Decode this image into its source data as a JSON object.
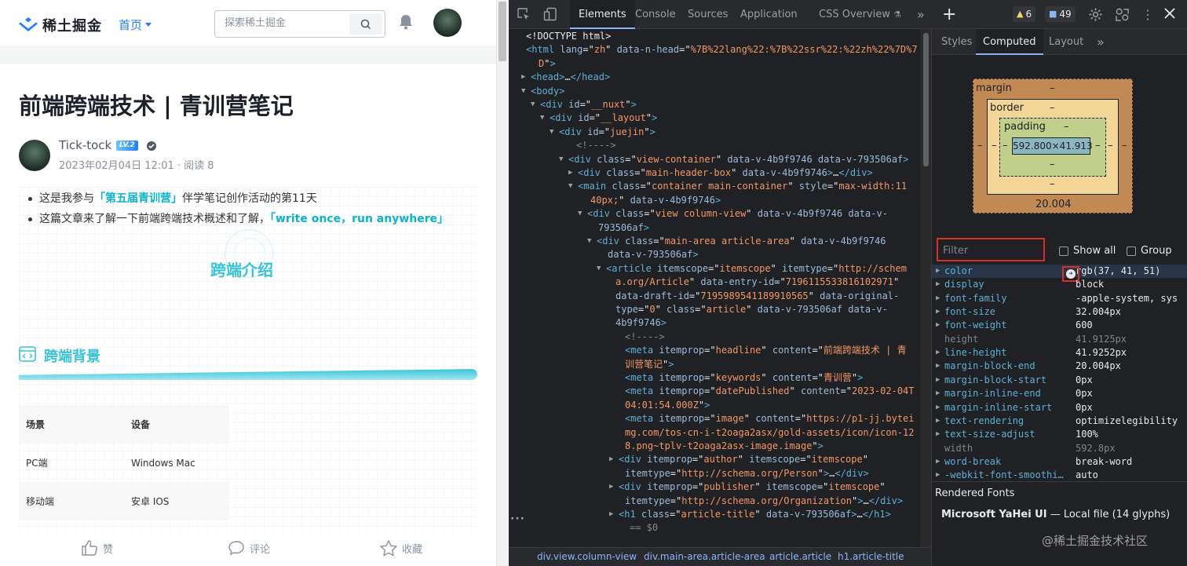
{
  "page": {
    "logo_text": "稀土掘金",
    "nav_home": "首页",
    "search_placeholder": "探索稀土掘金",
    "article_title": "前端跨端技术 | 青训营笔记",
    "author": "Tick-tock",
    "level_badge": "LV.2",
    "meta": "2023年02月04日 12:01 ·  阅读 8",
    "bullets": [
      {
        "pre": "这是我参与",
        "hl": "「第五届青训营」",
        "post": "伴学笔记创作活动的第11天"
      },
      {
        "pre": "这篇文章来了解一下前端跨端技术概述和了解，",
        "hl": "「write once，run anywhere」",
        "post": ""
      }
    ],
    "banner_title": "跨端介绍",
    "section_title": "跨端背景",
    "table": {
      "headers": [
        "场景",
        "设备"
      ],
      "rows": [
        [
          "PC端",
          "Windows Mac"
        ],
        [
          "移动端",
          "安卓 IOS"
        ]
      ]
    },
    "actions": [
      "赞",
      "评论",
      "收藏"
    ]
  },
  "devtools": {
    "tabs": [
      "Elements",
      "Console",
      "Sources",
      "Application",
      "CSS Overview"
    ],
    "warnings": "6",
    "messages": "49",
    "dom_lines": [
      [
        {
          "c": "tx",
          "t": "<!DOCTYPE html>"
        }
      ],
      [
        {
          "c": "tg",
          "t": "<html "
        },
        {
          "c": "at",
          "t": "lang"
        },
        {
          "c": "tx",
          "t": "=\""
        },
        {
          "c": "av",
          "t": "zh"
        },
        {
          "c": "tx",
          "t": "\" "
        },
        {
          "c": "at",
          "t": "data-n-head"
        },
        {
          "c": "tx",
          "t": "=\""
        },
        {
          "c": "av",
          "t": "%7B%22lang%22:%7B%22ssr%22:%22zh%22%7D%7"
        }
      ],
      [
        {
          "c": "av",
          "t": "D"
        },
        {
          "c": "tx",
          "t": "\""
        },
        {
          "c": "tg",
          "t": ">"
        }
      ],
      [
        {
          "c": "tg",
          "t": "<head>"
        },
        {
          "c": "tx",
          "t": "…"
        },
        {
          "c": "tg",
          "t": "</head>"
        }
      ],
      [
        {
          "c": "tg",
          "t": "<body>"
        }
      ],
      [
        {
          "c": "tg",
          "t": "<div "
        },
        {
          "c": "at",
          "t": "id"
        },
        {
          "c": "tx",
          "t": "=\""
        },
        {
          "c": "av",
          "t": "__nuxt"
        },
        {
          "c": "tx",
          "t": "\""
        },
        {
          "c": "tg",
          "t": ">"
        }
      ],
      [
        {
          "c": "tg",
          "t": "<div "
        },
        {
          "c": "at",
          "t": "id"
        },
        {
          "c": "tx",
          "t": "=\""
        },
        {
          "c": "av",
          "t": "__layout"
        },
        {
          "c": "tx",
          "t": "\""
        },
        {
          "c": "tg",
          "t": ">"
        }
      ],
      [
        {
          "c": "tg",
          "t": "<div "
        },
        {
          "c": "at",
          "t": "id"
        },
        {
          "c": "tx",
          "t": "=\""
        },
        {
          "c": "av",
          "t": "juejin"
        },
        {
          "c": "tx",
          "t": "\""
        },
        {
          "c": "tg",
          "t": ">"
        }
      ],
      [
        {
          "c": "cm",
          "t": "<!---->"
        }
      ],
      [
        {
          "c": "tg",
          "t": "<div "
        },
        {
          "c": "at",
          "t": "class"
        },
        {
          "c": "tx",
          "t": "=\""
        },
        {
          "c": "av",
          "t": "view-container"
        },
        {
          "c": "tx",
          "t": "\" "
        },
        {
          "c": "at",
          "t": "data-v-4b9f9746 data-v-793506af"
        },
        {
          "c": "tg",
          "t": ">"
        }
      ],
      [
        {
          "c": "tg",
          "t": "<div "
        },
        {
          "c": "at",
          "t": "class"
        },
        {
          "c": "tx",
          "t": "=\""
        },
        {
          "c": "av",
          "t": "main-header-box"
        },
        {
          "c": "tx",
          "t": "\" "
        },
        {
          "c": "at",
          "t": "data-v-4b9f9746"
        },
        {
          "c": "tg",
          "t": ">"
        },
        {
          "c": "tx",
          "t": "…"
        },
        {
          "c": "tg",
          "t": "</div>"
        }
      ],
      [
        {
          "c": "tg",
          "t": "<main "
        },
        {
          "c": "at",
          "t": "class"
        },
        {
          "c": "tx",
          "t": "=\""
        },
        {
          "c": "av",
          "t": "container main-container"
        },
        {
          "c": "tx",
          "t": "\" "
        },
        {
          "c": "at",
          "t": "style"
        },
        {
          "c": "tx",
          "t": "=\""
        },
        {
          "c": "av",
          "t": "max-width:11"
        }
      ],
      [
        {
          "c": "av",
          "t": "40px;"
        },
        {
          "c": "tx",
          "t": "\" "
        },
        {
          "c": "at",
          "t": "data-v-4b9f9746"
        },
        {
          "c": "tg",
          "t": ">"
        }
      ],
      [
        {
          "c": "tg",
          "t": "<div "
        },
        {
          "c": "at",
          "t": "class"
        },
        {
          "c": "tx",
          "t": "=\""
        },
        {
          "c": "av",
          "t": "view column-view"
        },
        {
          "c": "tx",
          "t": "\" "
        },
        {
          "c": "at",
          "t": "data-v-4b9f9746 data-v-"
        }
      ],
      [
        {
          "c": "at",
          "t": "793506af"
        },
        {
          "c": "tg",
          "t": ">"
        }
      ],
      [
        {
          "c": "tg",
          "t": "<div "
        },
        {
          "c": "at",
          "t": "class"
        },
        {
          "c": "tx",
          "t": "=\""
        },
        {
          "c": "av",
          "t": "main-area article-area"
        },
        {
          "c": "tx",
          "t": "\" "
        },
        {
          "c": "at",
          "t": "data-v-4b9f9746"
        }
      ],
      [
        {
          "c": "at",
          "t": "data-v-793506af"
        },
        {
          "c": "tg",
          "t": ">"
        }
      ],
      [
        {
          "c": "tg",
          "t": "<article "
        },
        {
          "c": "at",
          "t": "itemscope"
        },
        {
          "c": "tx",
          "t": "=\""
        },
        {
          "c": "av",
          "t": "itemscope"
        },
        {
          "c": "tx",
          "t": "\" "
        },
        {
          "c": "at",
          "t": "itemtype"
        },
        {
          "c": "tx",
          "t": "=\""
        },
        {
          "c": "av",
          "t": "http://schem"
        }
      ],
      [
        {
          "c": "av",
          "t": "a.org/Article"
        },
        {
          "c": "tx",
          "t": "\" "
        },
        {
          "c": "at",
          "t": "data-entry-id"
        },
        {
          "c": "tx",
          "t": "=\""
        },
        {
          "c": "av",
          "t": "7196115533816102971"
        },
        {
          "c": "tx",
          "t": "\""
        }
      ],
      [
        {
          "c": "at",
          "t": "data-draft-id"
        },
        {
          "c": "tx",
          "t": "=\""
        },
        {
          "c": "av",
          "t": "7195989541189910565"
        },
        {
          "c": "tx",
          "t": "\" "
        },
        {
          "c": "at",
          "t": "data-original-"
        }
      ],
      [
        {
          "c": "at",
          "t": "type"
        },
        {
          "c": "tx",
          "t": "=\""
        },
        {
          "c": "av",
          "t": "0"
        },
        {
          "c": "tx",
          "t": "\" "
        },
        {
          "c": "at",
          "t": "class"
        },
        {
          "c": "tx",
          "t": "=\""
        },
        {
          "c": "av",
          "t": "article"
        },
        {
          "c": "tx",
          "t": "\" "
        },
        {
          "c": "at",
          "t": "data-v-793506af data-v-"
        }
      ],
      [
        {
          "c": "at",
          "t": "4b9f9746"
        },
        {
          "c": "tg",
          "t": ">"
        }
      ],
      [
        {
          "c": "cm",
          "t": "<!---->"
        }
      ],
      [
        {
          "c": "tg",
          "t": "<meta "
        },
        {
          "c": "at",
          "t": "itemprop"
        },
        {
          "c": "tx",
          "t": "=\""
        },
        {
          "c": "av",
          "t": "headline"
        },
        {
          "c": "tx",
          "t": "\" "
        },
        {
          "c": "at",
          "t": "content"
        },
        {
          "c": "tx",
          "t": "=\""
        },
        {
          "c": "av",
          "t": "前端跨端技术 | 青"
        }
      ],
      [
        {
          "c": "av",
          "t": "训营笔记"
        },
        {
          "c": "tx",
          "t": "\""
        },
        {
          "c": "tg",
          "t": ">"
        }
      ],
      [
        {
          "c": "tg",
          "t": "<meta "
        },
        {
          "c": "at",
          "t": "itemprop"
        },
        {
          "c": "tx",
          "t": "=\""
        },
        {
          "c": "av",
          "t": "keywords"
        },
        {
          "c": "tx",
          "t": "\" "
        },
        {
          "c": "at",
          "t": "content"
        },
        {
          "c": "tx",
          "t": "=\""
        },
        {
          "c": "av",
          "t": "青训营"
        },
        {
          "c": "tx",
          "t": "\""
        },
        {
          "c": "tg",
          "t": ">"
        }
      ],
      [
        {
          "c": "tg",
          "t": "<meta "
        },
        {
          "c": "at",
          "t": "itemprop"
        },
        {
          "c": "tx",
          "t": "=\""
        },
        {
          "c": "av",
          "t": "datePublished"
        },
        {
          "c": "tx",
          "t": "\" "
        },
        {
          "c": "at",
          "t": "content"
        },
        {
          "c": "tx",
          "t": "=\""
        },
        {
          "c": "av",
          "t": "2023-02-04T"
        }
      ],
      [
        {
          "c": "av",
          "t": "04:01:54.000Z"
        },
        {
          "c": "tx",
          "t": "\""
        },
        {
          "c": "tg",
          "t": ">"
        }
      ],
      [
        {
          "c": "tg",
          "t": "<meta "
        },
        {
          "c": "at",
          "t": "itemprop"
        },
        {
          "c": "tx",
          "t": "=\""
        },
        {
          "c": "av",
          "t": "image"
        },
        {
          "c": "tx",
          "t": "\" "
        },
        {
          "c": "at",
          "t": "content"
        },
        {
          "c": "tx",
          "t": "=\""
        },
        {
          "c": "av",
          "t": "https://p1-jj.bytei"
        }
      ],
      [
        {
          "c": "av",
          "t": "mg.com/tos-cn-i-t2oaga2asx/gold-assets/icon/icon-12"
        }
      ],
      [
        {
          "c": "av",
          "t": "8.png~tplv-t2oaga2asx-image.image"
        },
        {
          "c": "tx",
          "t": "\""
        },
        {
          "c": "tg",
          "t": ">"
        }
      ],
      [
        {
          "c": "tg",
          "t": "<div "
        },
        {
          "c": "at",
          "t": "itemprop"
        },
        {
          "c": "tx",
          "t": "=\""
        },
        {
          "c": "av",
          "t": "author"
        },
        {
          "c": "tx",
          "t": "\" "
        },
        {
          "c": "at",
          "t": "itemscope"
        },
        {
          "c": "tx",
          "t": "=\""
        },
        {
          "c": "av",
          "t": "itemscope"
        },
        {
          "c": "tx",
          "t": "\""
        }
      ],
      [
        {
          "c": "at",
          "t": "itemtype"
        },
        {
          "c": "tx",
          "t": "=\""
        },
        {
          "c": "av",
          "t": "http://schema.org/Person"
        },
        {
          "c": "tx",
          "t": "\""
        },
        {
          "c": "tg",
          "t": ">"
        },
        {
          "c": "tx",
          "t": "…"
        },
        {
          "c": "tg",
          "t": "</div>"
        }
      ],
      [
        {
          "c": "tg",
          "t": "<div "
        },
        {
          "c": "at",
          "t": "itemprop"
        },
        {
          "c": "tx",
          "t": "=\""
        },
        {
          "c": "av",
          "t": "publisher"
        },
        {
          "c": "tx",
          "t": "\" "
        },
        {
          "c": "at",
          "t": "itemscope"
        },
        {
          "c": "tx",
          "t": "=\""
        },
        {
          "c": "av",
          "t": "itemscope"
        },
        {
          "c": "tx",
          "t": "\""
        }
      ],
      [
        {
          "c": "at",
          "t": "itemtype"
        },
        {
          "c": "tx",
          "t": "=\""
        },
        {
          "c": "av",
          "t": "http://schema.org/Organization"
        },
        {
          "c": "tx",
          "t": "\""
        },
        {
          "c": "tg",
          "t": ">"
        },
        {
          "c": "tx",
          "t": "…"
        },
        {
          "c": "tg",
          "t": "</div>"
        }
      ],
      [
        {
          "c": "tg",
          "t": "<h1 "
        },
        {
          "c": "at",
          "t": "class"
        },
        {
          "c": "tx",
          "t": "=\""
        },
        {
          "c": "av",
          "t": "article-title"
        },
        {
          "c": "tx",
          "t": "\" "
        },
        {
          "c": "at",
          "t": "data-v-793506af"
        },
        {
          "c": "tg",
          "t": ">"
        },
        {
          "c": "tx",
          "t": "…"
        },
        {
          "c": "tg",
          "t": "</h1>"
        }
      ],
      [
        {
          "c": "cm",
          "t": "== $0"
        }
      ]
    ],
    "breadcrumbs": [
      "div.view.column-view",
      "div.main-area.article-area",
      "article.article",
      "h1.article-title"
    ],
    "side_tabs": [
      "Styles",
      "Computed",
      "Layout"
    ],
    "box_model": {
      "margin": "margin",
      "border": "border",
      "padding": "padding",
      "content": "592.800×41.913",
      "margin_bottom": "20.004",
      "dash": "–"
    },
    "filter_placeholder": "Filter",
    "show_all": "Show all",
    "group": "Group",
    "props": [
      {
        "n": "color",
        "v": "rgb(37, 41, 51)",
        "dim": false
      },
      {
        "n": "display",
        "v": "block",
        "dim": false
      },
      {
        "n": "font-family",
        "v": "-apple-system, sys",
        "dim": false
      },
      {
        "n": "font-size",
        "v": "32.004px",
        "dim": false
      },
      {
        "n": "font-weight",
        "v": "600",
        "dim": false
      },
      {
        "n": "height",
        "v": "41.9125px",
        "dim": true
      },
      {
        "n": "line-height",
        "v": "41.9252px",
        "dim": false
      },
      {
        "n": "margin-block-end",
        "v": "20.004px",
        "dim": false
      },
      {
        "n": "margin-block-start",
        "v": "0px",
        "dim": false
      },
      {
        "n": "margin-inline-end",
        "v": "0px",
        "dim": false
      },
      {
        "n": "margin-inline-start",
        "v": "0px",
        "dim": false
      },
      {
        "n": "text-rendering",
        "v": "optimizelegibility",
        "dim": false
      },
      {
        "n": "text-size-adjust",
        "v": "100%",
        "dim": false
      },
      {
        "n": "width",
        "v": "592.8px",
        "dim": true
      },
      {
        "n": "word-break",
        "v": "break-word",
        "dim": false
      },
      {
        "n": "-webkit-font-smoothi…",
        "v": "auto",
        "dim": false
      }
    ],
    "rendered_fonts": "Rendered Fonts",
    "font_line": "Microsoft YaHei UI  —  Local file (14 glyphs)"
  },
  "watermark": "@稀土掘金技术社区"
}
